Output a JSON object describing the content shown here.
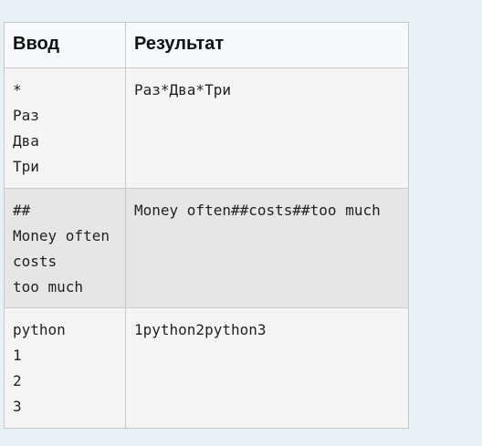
{
  "table": {
    "headers": [
      "Ввод",
      "Результат"
    ],
    "rows": [
      {
        "input": [
          "*",
          "Раз",
          "Два",
          "Три"
        ],
        "result": "Раз*Два*Три"
      },
      {
        "input": [
          "##",
          "Money often",
          "costs",
          "too much"
        ],
        "result": "Money often##costs##too much"
      },
      {
        "input": [
          "python",
          "1",
          "2",
          "3"
        ],
        "result": "1python2python3"
      }
    ]
  }
}
